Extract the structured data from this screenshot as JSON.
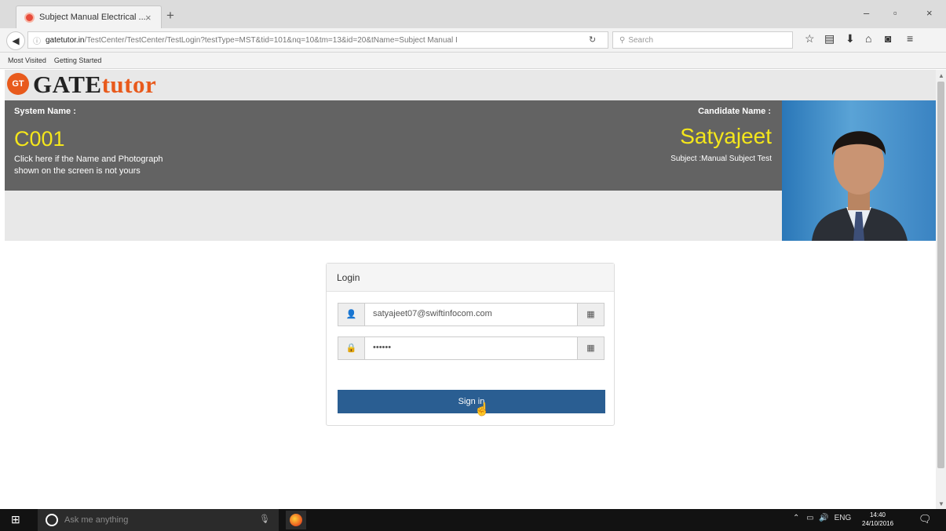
{
  "browser": {
    "tab_title": "Subject Manual Electrical ...",
    "tab_close": "×",
    "new_tab": "+",
    "url_host": "gatetutor.in",
    "url_path": "/TestCenter/TestCenter/TestLogin?testType=MST&tid=101&nq=10&tm=13&id=20&tName=Subject Manual I",
    "search_placeholder": "Search",
    "bookmarks": [
      "Most Visited",
      "Getting Started"
    ],
    "window_controls": {
      "minimize": "–",
      "restore": "▫",
      "close": "×"
    }
  },
  "header": {
    "logo_badge": "GT",
    "logo_gate": "GATE",
    "logo_tutor": "tutor"
  },
  "banner": {
    "system_label": "System Name :",
    "system_value": "C001",
    "note_line1": "Click here if the Name and Photograph",
    "note_line2": "shown on the screen is not yours",
    "candidate_label": "Candidate Name :",
    "candidate_value": "Satyajeet",
    "subject": "Subject :Manual Subject Test"
  },
  "login": {
    "title": "Login",
    "email_value": "satyajeet07@swiftinfocom.com",
    "password_value": "••••••",
    "signin_label": "Sign in"
  },
  "taskbar": {
    "cortana_placeholder": "Ask me anything",
    "tray_lang": "ENG",
    "time": "14:40",
    "date": "24/10/2016"
  },
  "colors": {
    "banner_bg": "#636363",
    "highlight_yellow": "#f4e61b",
    "brand_orange": "#e85a1c",
    "signin_blue": "#2a5e92"
  }
}
